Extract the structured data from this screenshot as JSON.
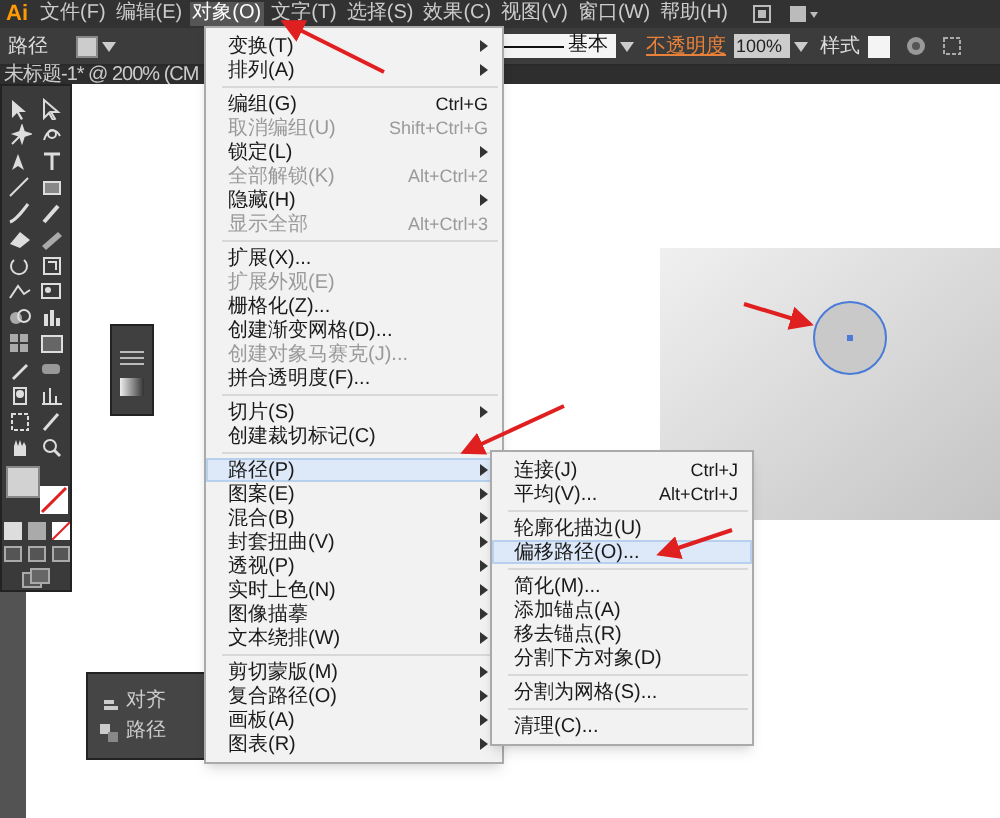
{
  "app_logo": "Ai",
  "menubar": [
    {
      "label": "文件(F)",
      "selected": false
    },
    {
      "label": "编辑(E)",
      "selected": false
    },
    {
      "label": "对象(O)",
      "selected": true
    },
    {
      "label": "文字(T)",
      "selected": false
    },
    {
      "label": "选择(S)",
      "selected": false
    },
    {
      "label": "效果(C)",
      "selected": false
    },
    {
      "label": "视图(V)",
      "selected": false
    },
    {
      "label": "窗口(W)",
      "selected": false
    },
    {
      "label": "帮助(H)",
      "selected": false
    }
  ],
  "control_bar": {
    "selection_label": "路径",
    "stroke_profile": "基本",
    "opacity_label": "不透明度",
    "opacity_value": "100%",
    "style_label": "样式"
  },
  "document_tab": {
    "title": "未标题-1* @ 200% (CM"
  },
  "object_menu": [
    {
      "kind": "item",
      "label": "变换(T)",
      "submenu": true,
      "disabled": false,
      "selected": false
    },
    {
      "kind": "item",
      "label": "排列(A)",
      "submenu": true,
      "disabled": false,
      "selected": false
    },
    {
      "kind": "separator"
    },
    {
      "kind": "item",
      "label": "编组(G)",
      "shortcut": "Ctrl+G",
      "submenu": false,
      "disabled": false,
      "selected": false
    },
    {
      "kind": "item",
      "label": "取消编组(U)",
      "shortcut": "Shift+Ctrl+G",
      "submenu": false,
      "disabled": true,
      "selected": false
    },
    {
      "kind": "item",
      "label": "锁定(L)",
      "submenu": true,
      "disabled": false,
      "selected": false
    },
    {
      "kind": "item",
      "label": "全部解锁(K)",
      "shortcut": "Alt+Ctrl+2",
      "submenu": false,
      "disabled": true,
      "selected": false
    },
    {
      "kind": "item",
      "label": "隐藏(H)",
      "submenu": true,
      "disabled": false,
      "selected": false
    },
    {
      "kind": "item",
      "label": "显示全部",
      "shortcut": "Alt+Ctrl+3",
      "submenu": false,
      "disabled": true,
      "selected": false
    },
    {
      "kind": "separator"
    },
    {
      "kind": "item",
      "label": "扩展(X)...",
      "submenu": false,
      "disabled": false,
      "selected": false
    },
    {
      "kind": "item",
      "label": "扩展外观(E)",
      "submenu": false,
      "disabled": true,
      "selected": false
    },
    {
      "kind": "item",
      "label": "栅格化(Z)...",
      "submenu": false,
      "disabled": false,
      "selected": false
    },
    {
      "kind": "item",
      "label": "创建渐变网格(D)...",
      "submenu": false,
      "disabled": false,
      "selected": false
    },
    {
      "kind": "item",
      "label": "创建对象马赛克(J)...",
      "submenu": false,
      "disabled": true,
      "selected": false
    },
    {
      "kind": "item",
      "label": "拼合透明度(F)...",
      "submenu": false,
      "disabled": false,
      "selected": false
    },
    {
      "kind": "separator"
    },
    {
      "kind": "item",
      "label": "切片(S)",
      "submenu": true,
      "disabled": false,
      "selected": false
    },
    {
      "kind": "item",
      "label": "创建裁切标记(C)",
      "submenu": false,
      "disabled": false,
      "selected": false
    },
    {
      "kind": "separator"
    },
    {
      "kind": "item",
      "label": "路径(P)",
      "submenu": true,
      "disabled": false,
      "selected": true
    },
    {
      "kind": "item",
      "label": "图案(E)",
      "submenu": true,
      "disabled": false,
      "selected": false
    },
    {
      "kind": "item",
      "label": "混合(B)",
      "submenu": true,
      "disabled": false,
      "selected": false
    },
    {
      "kind": "item",
      "label": "封套扭曲(V)",
      "submenu": true,
      "disabled": false,
      "selected": false
    },
    {
      "kind": "item",
      "label": "透视(P)",
      "submenu": true,
      "disabled": false,
      "selected": false
    },
    {
      "kind": "item",
      "label": "实时上色(N)",
      "submenu": true,
      "disabled": false,
      "selected": false
    },
    {
      "kind": "item",
      "label": "图像描摹",
      "submenu": true,
      "disabled": false,
      "selected": false
    },
    {
      "kind": "item",
      "label": "文本绕排(W)",
      "submenu": true,
      "disabled": false,
      "selected": false
    },
    {
      "kind": "separator"
    },
    {
      "kind": "item",
      "label": "剪切蒙版(M)",
      "submenu": true,
      "disabled": false,
      "selected": false
    },
    {
      "kind": "item",
      "label": "复合路径(O)",
      "submenu": true,
      "disabled": false,
      "selected": false
    },
    {
      "kind": "item",
      "label": "画板(A)",
      "submenu": true,
      "disabled": false,
      "selected": false
    },
    {
      "kind": "item",
      "label": "图表(R)",
      "submenu": true,
      "disabled": false,
      "selected": false
    }
  ],
  "path_submenu": [
    {
      "kind": "item",
      "label": "连接(J)",
      "shortcut": "Ctrl+J",
      "selected": false
    },
    {
      "kind": "item",
      "label": "平均(V)...",
      "shortcut": "Alt+Ctrl+J",
      "selected": false
    },
    {
      "kind": "separator"
    },
    {
      "kind": "item",
      "label": "轮廓化描边(U)",
      "selected": false
    },
    {
      "kind": "item",
      "label": "偏移路径(O)...",
      "selected": true
    },
    {
      "kind": "separator"
    },
    {
      "kind": "item",
      "label": "简化(M)...",
      "selected": false
    },
    {
      "kind": "item",
      "label": "添加锚点(A)",
      "selected": false
    },
    {
      "kind": "item",
      "label": "移去锚点(R)",
      "selected": false
    },
    {
      "kind": "item",
      "label": "分割下方对象(D)",
      "selected": false
    },
    {
      "kind": "separator"
    },
    {
      "kind": "item",
      "label": "分割为网格(S)...",
      "selected": false
    },
    {
      "kind": "separator"
    },
    {
      "kind": "item",
      "label": "清理(C)...",
      "selected": false
    }
  ],
  "align_panel": {
    "items": [
      "对齐",
      "路径"
    ]
  }
}
